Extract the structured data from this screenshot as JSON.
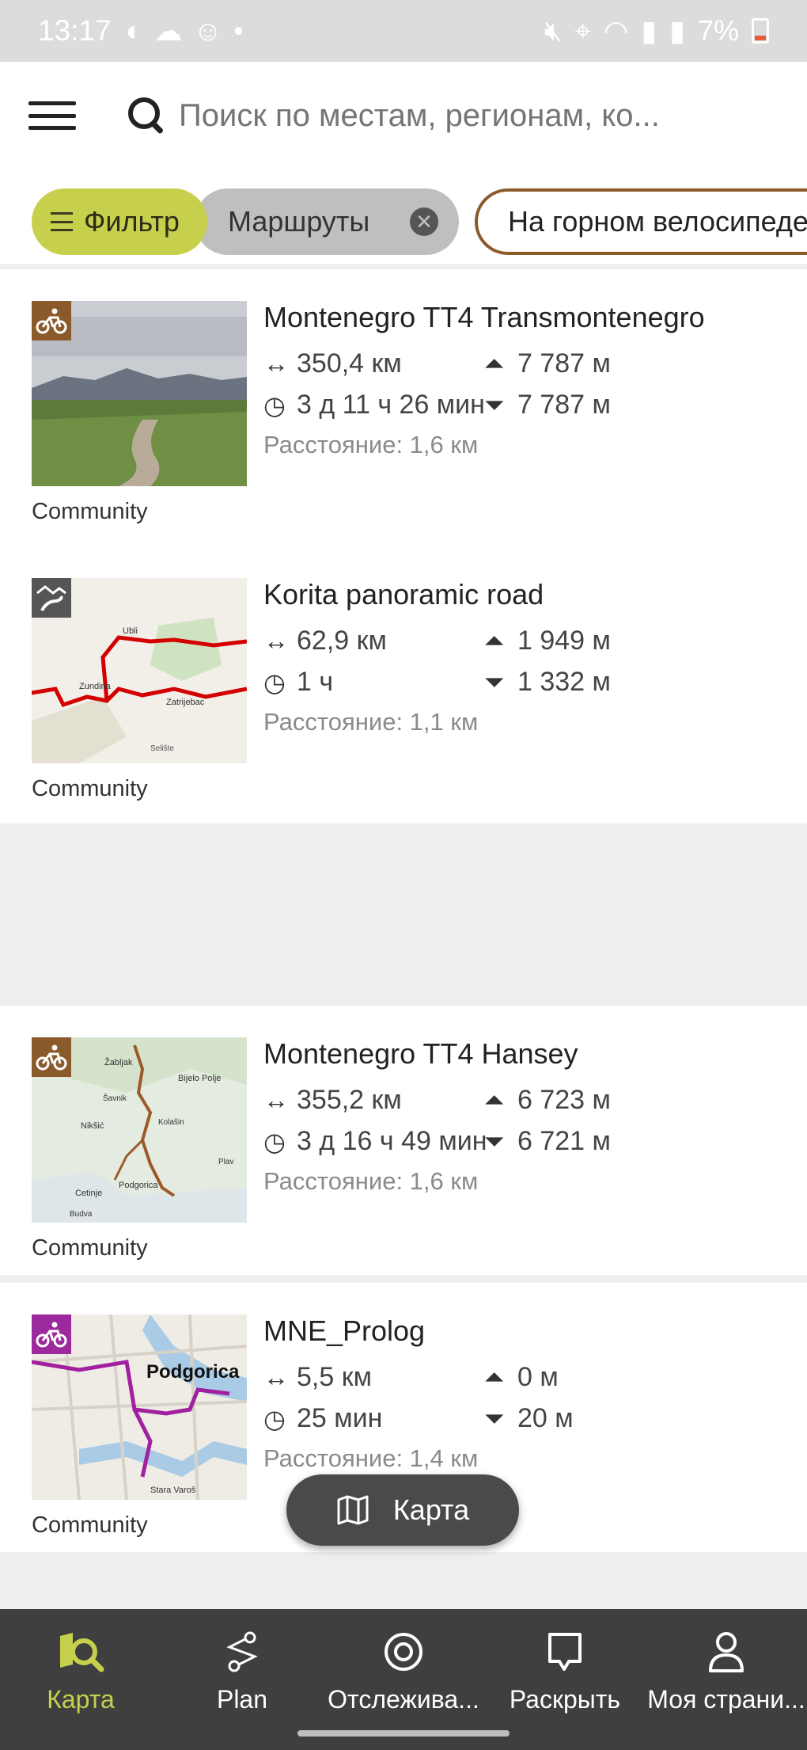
{
  "status": {
    "time": "13:17",
    "battery": "7%"
  },
  "search": {
    "placeholder": "Поиск по местам, регионам, ко..."
  },
  "chips": {
    "filter": "Фильтр",
    "routes": "Маршруты",
    "bike": "На горном велосипеде"
  },
  "routes": [
    {
      "title": "Montenegro TT4 Transmontenegro",
      "distance": "350,4 км",
      "duration": "3 д 11 ч 26 мин",
      "ascent": "7 787 м",
      "descent": "7 787 м",
      "proximity": "Расстояние: 1,6 км",
      "source": "Community",
      "badge_color": "#8b5a2b",
      "badge_icon": "mountain-bike-icon"
    },
    {
      "title": "Korita panoramic road",
      "distance": "62,9 км",
      "duration": "1 ч",
      "ascent": "1 949 м",
      "descent": "1 332 м",
      "proximity": "Расстояние: 1,1 км",
      "source": "Community",
      "badge_color": "#555555",
      "badge_icon": "road-icon",
      "map_labels": [
        "Ubli",
        "Zundina",
        "Zatrijebac",
        "Selište"
      ]
    },
    {
      "title": "Montenegro TT4 Hansey",
      "distance": "355,2 км",
      "duration": "3 д 16 ч 49 мин",
      "ascent": "6 723 м",
      "descent": "6 721 м",
      "proximity": "Расстояние: 1,6 км",
      "source": "Community",
      "badge_color": "#8b5a2b",
      "badge_icon": "mountain-bike-icon",
      "map_labels": [
        "Žabljak",
        "Bijelo Polje",
        "Šavnik",
        "Nikšić",
        "Kolašin",
        "Plav",
        "Cetinje",
        "Podgorica",
        "Budva"
      ]
    },
    {
      "title": "MNE_Prolog",
      "distance": "5,5 км",
      "duration": "25 мин",
      "ascent": "0 м",
      "descent": "20 м",
      "proximity": "Расстояние: 1,4 км",
      "source": "Community",
      "badge_color": "#9c2a9c",
      "badge_icon": "bike-icon",
      "map_labels": [
        "Podgorica",
        "Stara Varoš"
      ]
    }
  ],
  "fab": {
    "label": "Карта"
  },
  "nav": {
    "map": "Карта",
    "plan": "Plan",
    "track": "Отслежива...",
    "discover": "Раскрыть",
    "profile": "Моя страни..."
  },
  "colors": {
    "accent": "#c6d04c",
    "nav_bg": "#3f3f3f",
    "bike_chip_border": "#8b5a2b"
  }
}
